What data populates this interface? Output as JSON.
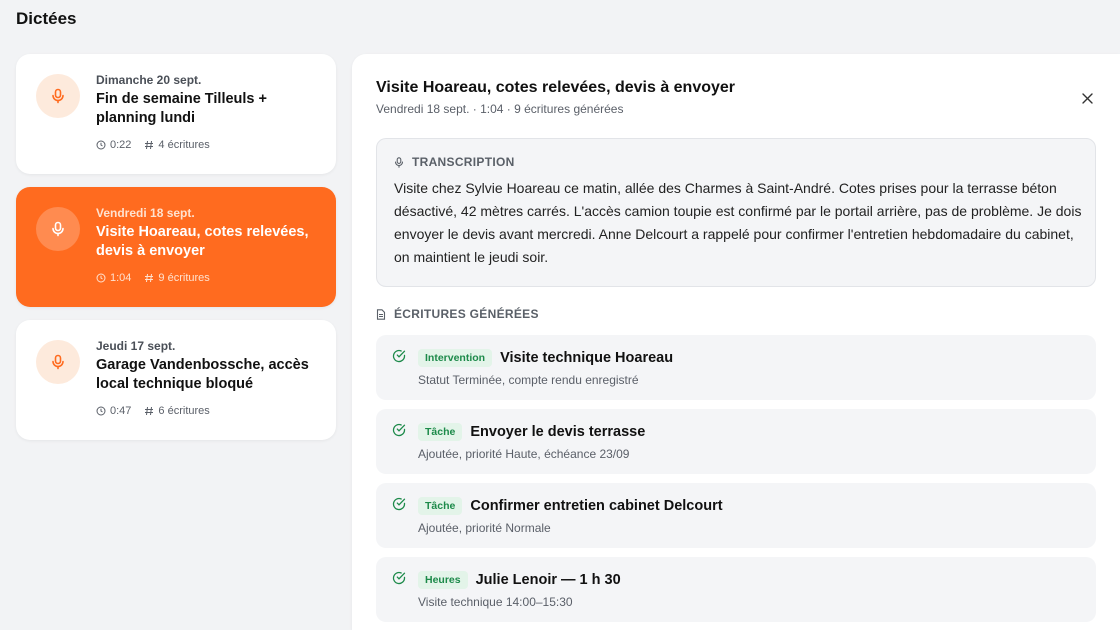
{
  "page": {
    "title": "Dictées"
  },
  "dictations": [
    {
      "date": "Dimanche 20 sept.",
      "title": "Fin de semaine Tilleuls + planning lundi",
      "duration": "0:22",
      "entries": "4 écritures",
      "active": false
    },
    {
      "date": "Vendredi 18 sept.",
      "title": "Visite Hoareau, cotes relevées, devis à envoyer",
      "duration": "1:04",
      "entries": "9 écritures",
      "active": true
    },
    {
      "date": "Jeudi 17 sept.",
      "title": "Garage Vandenbossche, accès local technique bloqué",
      "duration": "0:47",
      "entries": "6 écritures",
      "active": false
    }
  ],
  "detail": {
    "title": "Visite Hoareau, cotes relevées, devis à envoyer",
    "subtitle": "Vendredi 18 sept. · 1:04 · 9 écritures générées",
    "transcription_label": "TRANSCRIPTION",
    "transcription_text": "Visite chez Sylvie Hoareau ce matin, allée des Charmes à Saint-André. Cotes prises pour la terrasse béton désactivé, 42 mètres carrés. L'accès camion toupie est confirmé par le portail arrière, pas de problème. Je dois envoyer le devis avant mercredi. Anne Delcourt a rappelé pour confirmer l'entretien hebdomadaire du cabinet, on maintient le jeudi soir.",
    "entries_label": "ÉCRITURES GÉNÉRÉES",
    "entries": [
      {
        "badge": "Intervention",
        "title": "Visite technique Hoareau",
        "desc": "Statut Terminée, compte rendu enregistré"
      },
      {
        "badge": "Tâche",
        "title": "Envoyer le devis terrasse",
        "desc": "Ajoutée, priorité Haute, échéance 23/09"
      },
      {
        "badge": "Tâche",
        "title": "Confirmer entretien cabinet Delcourt",
        "desc": "Ajoutée, priorité Normale"
      },
      {
        "badge": "Heures",
        "title": "Julie Lenoir — 1 h 30",
        "desc": "Visite technique 14:00–15:30"
      }
    ]
  },
  "colors": {
    "accent": "#ff6b1f",
    "accent_soft": "#fdeadc",
    "success": "#1d8a4a",
    "success_soft": "#e3f4e9"
  },
  "icons": {
    "card": "microphone-icon",
    "duration": "clock-icon",
    "count": "hash-icon",
    "close": "close-icon",
    "transcription": "microphone-icon",
    "entries": "document-icon",
    "entry": "check-circle-icon"
  }
}
